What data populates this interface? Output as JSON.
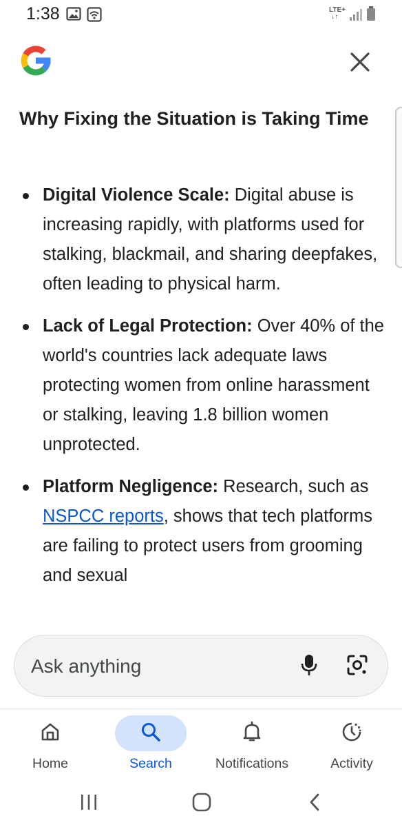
{
  "status_bar": {
    "time": "1:38",
    "network_label": "LTE+",
    "network_arrows": "↓↑",
    "icons": [
      "gallery-icon",
      "wifi-icon",
      "signal-icon",
      "battery-icon"
    ]
  },
  "header": {
    "logo": "google-g-logo",
    "close_icon": "close-icon"
  },
  "content": {
    "heading": "Why Fixing the Situation is Taking Time",
    "bullets": [
      {
        "term": "Digital Violence Scale:",
        "text": " Digital abuse is increasing rapidly, with platforms used for stalking, blackmail, and sharing deepfakes, often leading to physical harm."
      },
      {
        "term": "Lack of Legal Protection:",
        "text": " Over 40% of the world's countries lack adequate laws protecting women from online harassment or stalking, leaving 1.8 billion women unprotected."
      },
      {
        "term": "Platform Negligence:",
        "text_before": " Research, such as ",
        "link": "NSPCC reports",
        "text_after": ", shows that tech platforms are failing to protect users from grooming and sexual"
      }
    ]
  },
  "ask_bar": {
    "placeholder": "Ask anything",
    "mic_icon": "microphone-icon",
    "lens_icon": "google-lens-icon"
  },
  "bottom_nav": {
    "items": [
      {
        "label": "Home",
        "icon": "home-icon",
        "active": false
      },
      {
        "label": "Search",
        "icon": "search-icon",
        "active": true
      },
      {
        "label": "Notifications",
        "icon": "bell-icon",
        "active": false
      },
      {
        "label": "Activity",
        "icon": "activity-icon",
        "active": false
      }
    ]
  },
  "system_nav": {
    "icons": [
      "recents-icon",
      "home-circle-icon",
      "back-icon"
    ]
  },
  "colors": {
    "accent_blue": "#0b57d0",
    "active_pill": "#d3e3fd",
    "text_primary": "#1f1f1f",
    "ask_bar_bg": "#f1f3f4",
    "google_blue": "#4285F4",
    "google_red": "#EA4335",
    "google_yellow": "#FBBC05",
    "google_green": "#34A853"
  }
}
